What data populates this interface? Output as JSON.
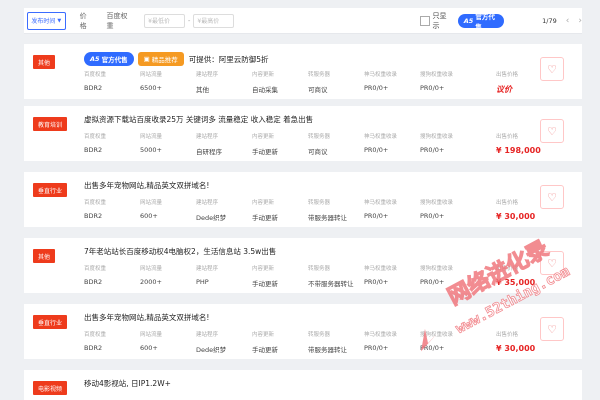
{
  "filter_bar": {
    "sort_label": "发布时间",
    "price_link": "价格",
    "weight_link": "百度权重",
    "min_price_placeholder": "¥最低价",
    "max_price_placeholder": "¥最高价",
    "only_show_label": "只显示",
    "official_badge": {
      "a5": "A5",
      "text": "官方代售"
    },
    "page_info": "1/79",
    "prev_arrow": "‹",
    "next_arrow": "›"
  },
  "column_headers": [
    "百度权重",
    "网站流量",
    "建站程序",
    "内容更新",
    "转服务器",
    "神马权重收录",
    "搜狗权重收录",
    "出售价格"
  ],
  "listings": [
    {
      "category": "其他",
      "has_official": true,
      "official_badge": {
        "a5": "A5",
        "text": "官方代售"
      },
      "has_quality": true,
      "quality_badge": "精品推荐",
      "title": "可提供：阿里云防御5折",
      "values": [
        "BDR2",
        "6500+",
        "其他",
        "自动采集",
        "可商议",
        "PR0/0+",
        "PR0/0+",
        "议价"
      ],
      "price_italic": true
    },
    {
      "category": "教育培训",
      "title": "虚拟资源下载站百度收录25万 关键词多 流量稳定 收入稳定 着急出售",
      "values": [
        "BDR2",
        "5000+",
        "自研程序",
        "手动更新",
        "可商议",
        "PR0/0+",
        "PR0/0+",
        "¥ 198,000"
      ]
    },
    {
      "category": "垂直行业",
      "title": "出售多年宠物网站,精品英文双拼域名!",
      "values": [
        "BDR2",
        "600+",
        "Dede织梦",
        "手动更新",
        "带服务器转让",
        "PR0/0+",
        "PR0/0+",
        "¥ 30,000"
      ]
    },
    {
      "category": "其他",
      "title": "7年老站站长百度移动权4电脑权2，生活信息站 3.5w出售",
      "values": [
        "BDR2",
        "2000+",
        "PHP",
        "手动更新",
        "不带服务器转让",
        "PR0/0+",
        "PR0/0+",
        "¥ 35,000"
      ]
    },
    {
      "category": "垂直行业",
      "title": "出售多年宠物网站,精品英文双拼域名!",
      "values": [
        "BDR2",
        "600+",
        "Dede织梦",
        "手动更新",
        "带服务器转让",
        "PR0/0+",
        "PR0/0+",
        "¥ 30,000"
      ]
    },
    {
      "category": "电影视频",
      "title": "移动4影视站, 日IP1.2W+"
    }
  ],
  "watermark": {
    "text": "网络进化录",
    "url": "www.52thing.com"
  },
  "colors": {
    "accent": "#2f6bff",
    "tag_red": "#ee3b1c",
    "price_red": "#e62424",
    "quality_orange": "#f59a22",
    "watermark_red": "#f0787e"
  }
}
